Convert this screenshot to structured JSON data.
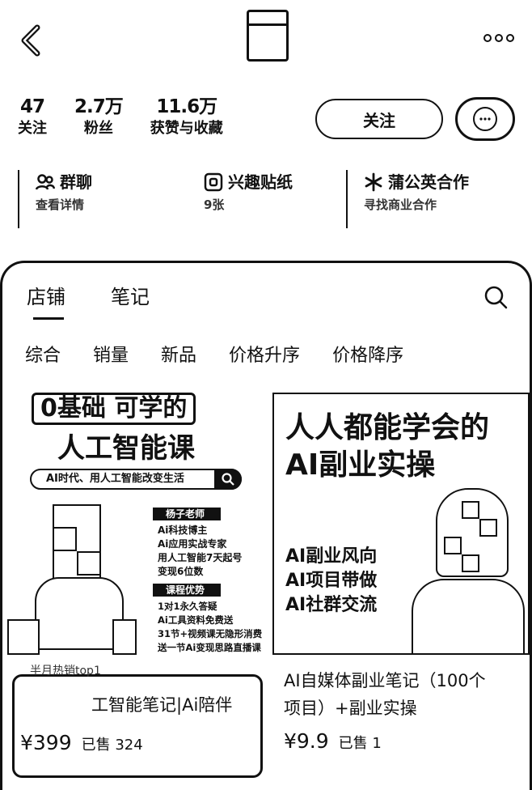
{
  "stats": [
    {
      "num": "47",
      "label": "关注"
    },
    {
      "num": "2.7万",
      "label": "粉丝"
    },
    {
      "num": "11.6万",
      "label": "获赞与收藏"
    }
  ],
  "follow_label": "关注",
  "features": [
    {
      "title": "群聊",
      "sub": "查看详情"
    },
    {
      "title": "兴趣贴纸",
      "sub": "9张"
    },
    {
      "title": "蒲公英合作",
      "sub": "寻找商业合作"
    }
  ],
  "tabs": [
    "店铺",
    "笔记"
  ],
  "filters": [
    "综合",
    "销量",
    "新品",
    "价格升序",
    "价格降序"
  ],
  "products": [
    {
      "banner": "0基础 可学的",
      "headline": "人工智能课",
      "search_text": "AI时代、用人工智能改变生活",
      "section1": "杨子老师",
      "bullets1": [
        "Ai科技博主",
        "Ai应用实战专家",
        "用人工智能7天起号",
        "变现6位数"
      ],
      "section2": "课程优势",
      "bullets2": [
        "1对1永久答疑",
        "Ai工具资料免费送",
        "31节+视频课无隐形消费",
        "送一节Ai变现思路直播课"
      ],
      "badge": "半月热销top1",
      "title": "工智能笔记|Ai陪伴",
      "price": "¥399",
      "sold": "已售 324"
    },
    {
      "headline1": "人人都能学会的",
      "headline2": "AI副业实操",
      "lines": [
        "AI副业风向",
        "AI项目带做",
        "AI社群交流"
      ],
      "title_line1": "AI自媒体副业笔记（100个",
      "title_line2": "项目）+副业实操",
      "price": "¥9.9",
      "sold": "已售 1"
    }
  ]
}
